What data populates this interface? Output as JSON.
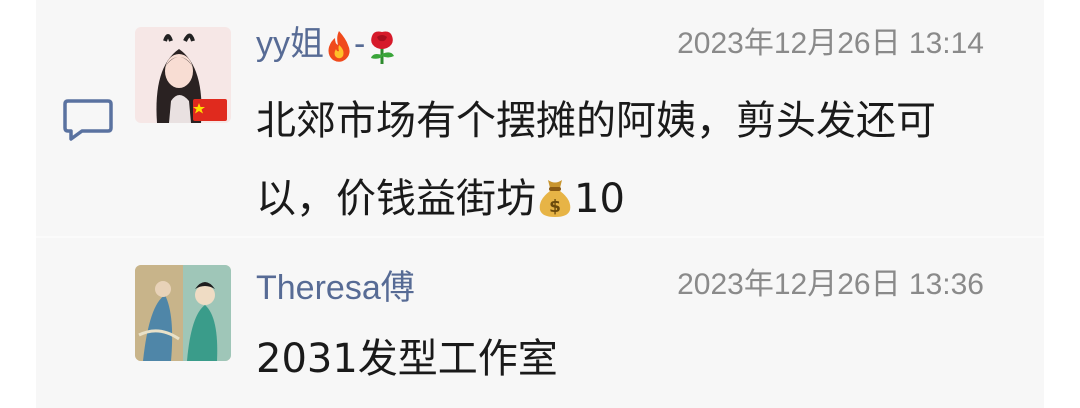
{
  "comments": [
    {
      "author": "yy姐",
      "author_suffix": "-",
      "author_emojis": [
        "fire-icon",
        "rose-icon"
      ],
      "timestamp": "2023年12月26日 13:14",
      "text_before_emoji": "北郊市场有个摆摊的阿姨，剪头发还可以，价钱益街坊",
      "inline_emoji": "money-bag-icon",
      "text_after_emoji": "10"
    },
    {
      "author": "Theresa傅",
      "timestamp": "2023年12月26日 13:36",
      "text": "2031发型工作室"
    }
  ],
  "colors": {
    "author": "#576b95",
    "timestamp": "#8a8a8a",
    "text": "#1a1a1a",
    "panel": "#f7f7f7"
  }
}
